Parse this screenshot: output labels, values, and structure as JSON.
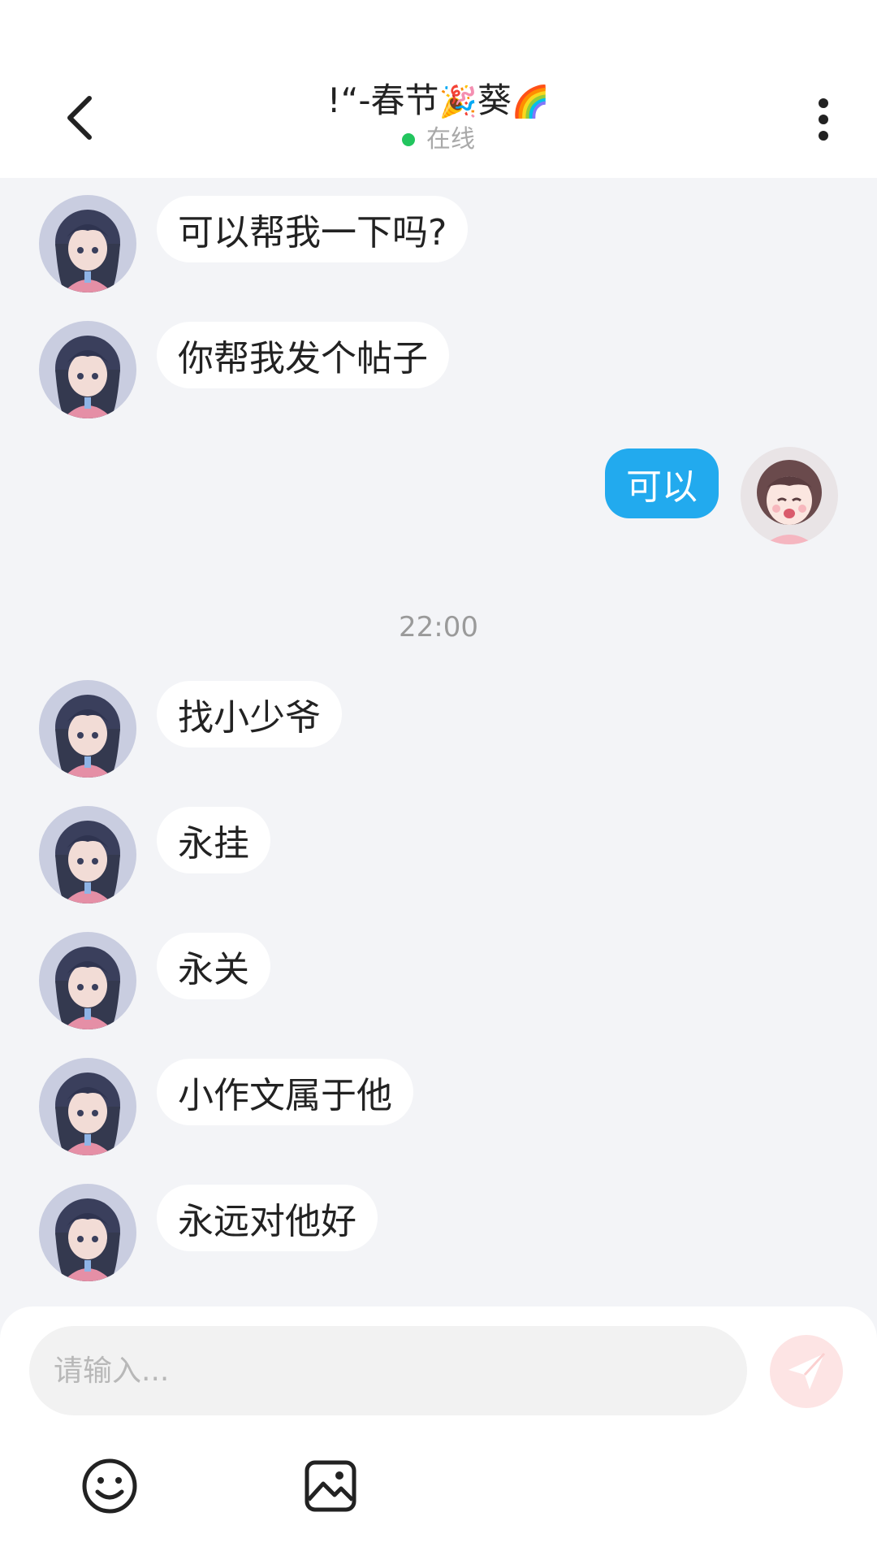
{
  "header": {
    "title_prefix": "!“-春节",
    "title_emoji_1": "🎉",
    "title_mid": "葵",
    "title_emoji_2": "🌈",
    "status": "在线"
  },
  "messages": [
    {
      "side": "left",
      "text": "可以帮我一下吗?"
    },
    {
      "side": "left",
      "text": "你帮我发个帖子"
    },
    {
      "side": "right",
      "text": "可以"
    },
    {
      "side": "left",
      "text": "找小少爷"
    },
    {
      "side": "left",
      "text": "永挂"
    },
    {
      "side": "left",
      "text": "永关"
    },
    {
      "side": "left",
      "text": "小作文属于他"
    },
    {
      "side": "left",
      "text": "永远对他好"
    }
  ],
  "timestamp": "22:00",
  "composer": {
    "placeholder": "请输入...",
    "send_icon": "send-icon",
    "emoji_icon": "emoji-icon",
    "image_icon": "image-icon"
  },
  "colors": {
    "own_bubble": "#22aaee",
    "status_dot": "#22c55e",
    "send_button_bg": "#fde4e4"
  }
}
